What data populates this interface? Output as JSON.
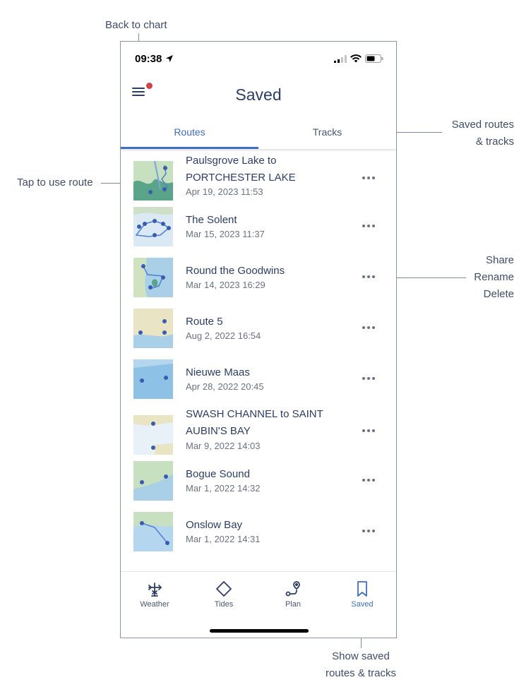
{
  "annotations": {
    "back_to_chart": "Back to chart",
    "saved_routes_line1": "Saved routes",
    "saved_routes_line2": "& tracks",
    "tap_to_use": "Tap to use route",
    "share": "Share",
    "rename": "Rename",
    "delete": "Delete",
    "show_saved_line1": "Show saved",
    "show_saved_line2": "routes & tracks"
  },
  "status_bar": {
    "time": "09:38"
  },
  "header": {
    "title": "Saved"
  },
  "tabs": [
    {
      "label": "Routes",
      "active": true
    },
    {
      "label": "Tracks",
      "active": false
    }
  ],
  "routes": [
    {
      "name": "Paulsgrove Lake to PORTCHESTER LAKE",
      "date": "Apr 19, 2023 11:53"
    },
    {
      "name": "The Solent",
      "date": "Mar 15, 2023 11:37"
    },
    {
      "name": "Round the Goodwins",
      "date": "Mar 14, 2023 16:29"
    },
    {
      "name": "Route 5",
      "date": "Aug 2, 2022 16:54"
    },
    {
      "name": "Nieuwe Maas",
      "date": "Apr 28, 2022 20:45"
    },
    {
      "name": "SWASH CHANNEL to SAINT AUBIN'S BAY",
      "date": "Mar 9, 2022 14:03"
    },
    {
      "name": "Bogue Sound",
      "date": "Mar 1, 2022 14:32"
    },
    {
      "name": "Onslow Bay",
      "date": "Mar 1, 2022 14:31"
    }
  ],
  "tabbar": [
    {
      "label": "Weather",
      "icon": "weather-vane-icon",
      "active": false
    },
    {
      "label": "Tides",
      "icon": "diamond-icon",
      "active": false
    },
    {
      "label": "Plan",
      "icon": "route-plan-icon",
      "active": false
    },
    {
      "label": "Saved",
      "icon": "bookmark-icon",
      "active": true
    }
  ],
  "colors": {
    "accent": "#3e6fc2",
    "text": "#2c3e66",
    "badge": "#d0434b"
  }
}
